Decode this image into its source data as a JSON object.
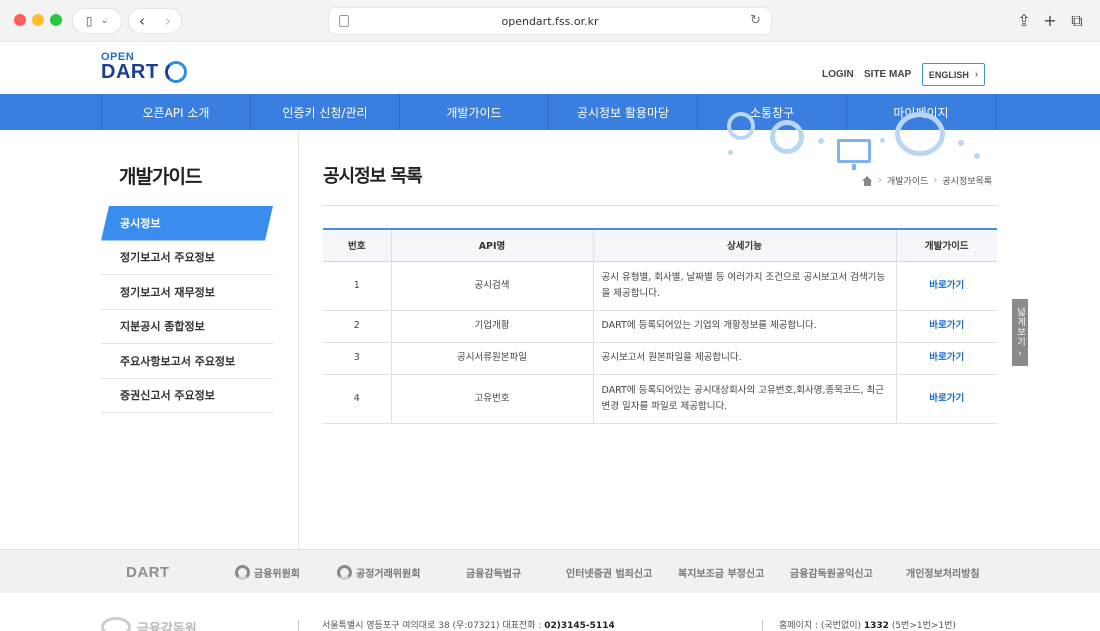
{
  "browser": {
    "url": "opendart.fss.or.kr"
  },
  "header": {
    "logo_top": "OPEN",
    "logo_main": "DART",
    "login": "LOGIN",
    "sitemap": "SITE MAP",
    "english": "ENGLISH"
  },
  "gnb": {
    "items": [
      "오픈API 소개",
      "인증키 신청/관리",
      "개발가이드",
      "공시정보 활용마당",
      "소통창구",
      "마이페이지"
    ]
  },
  "lnb": {
    "title": "개발가이드",
    "items": [
      "공시정보",
      "정기보고서 주요정보",
      "정기보고서 재무정보",
      "지분공시 종합정보",
      "주요사항보고서 주요정보",
      "증권신고서 주요정보"
    ]
  },
  "content": {
    "title": "공시정보 목록",
    "breadcrumb": [
      "개발가이드",
      "공시정보목록"
    ],
    "table": {
      "headers": [
        "번호",
        "API명",
        "상세기능",
        "개발가이드"
      ],
      "rows": [
        {
          "no": "1",
          "name": "공시검색",
          "desc": "공시 유형별, 회사별, 날짜별 등 여러가지 조건으로 공시보고서 검색기능을 제공합니다.",
          "link": "바로가기"
        },
        {
          "no": "2",
          "name": "기업개황",
          "desc": "DART에 등록되어있는 기업의 개황정보를 제공합니다.",
          "link": "바로가기"
        },
        {
          "no": "3",
          "name": "공시서류원본파일",
          "desc": "공시보고서 원본파일을 제공합니다.",
          "link": "바로가기"
        },
        {
          "no": "4",
          "name": "고유번호",
          "desc": "DART에 등록되어있는 공시대상회사의 고유번호,회사명,종목코드, 최근변경 일자를 파일로 제공합니다.",
          "link": "바로가기"
        }
      ]
    }
  },
  "side_tab": {
    "label": "넓게보기"
  },
  "footer": {
    "links": [
      "DART",
      "금융위원회",
      "공정거래위원회",
      "금융감독법규",
      "인터넷증권 범죄신고",
      "복지보조금 부정신고",
      "금융감독원공익신고",
      "개인정보처리방침"
    ],
    "logo_text": "금융감독원",
    "address": "서울특별시 영등포구 여의대로 38 (우:07321) 대표전화 : ",
    "phone": "02)3145-5114",
    "visit_label": "홈페이지 : (국번없이) ",
    "visit_number": "1332",
    "visit_suffix": " (5번>1번>1번)"
  }
}
